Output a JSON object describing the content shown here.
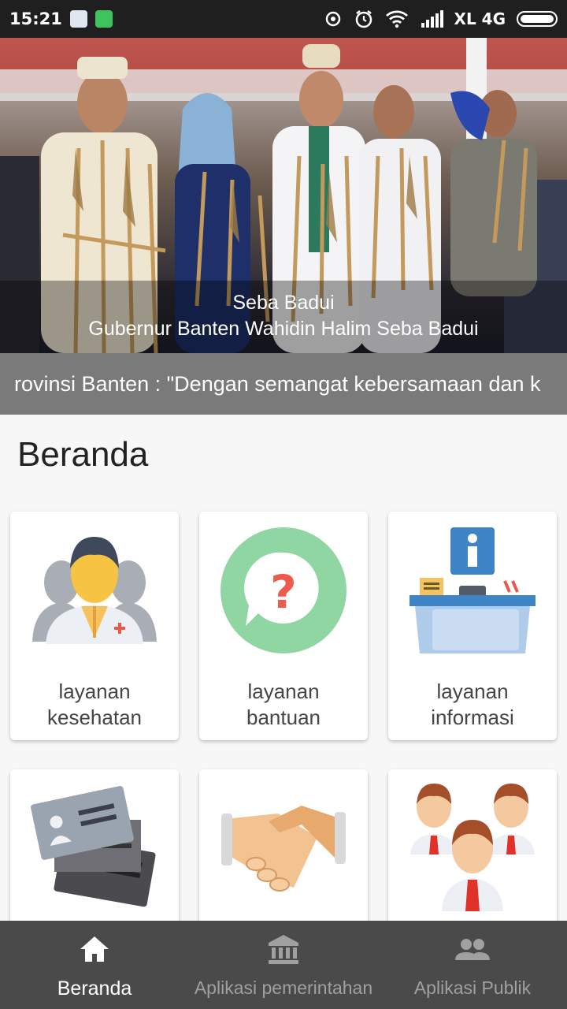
{
  "status_bar": {
    "time": "15:21",
    "carrier": "XL 4G",
    "icons": [
      "notification-app-icon",
      "whatsapp-icon",
      "sync-icon",
      "alarm-icon",
      "wifi-icon",
      "signal-icon",
      "battery-icon"
    ]
  },
  "hero": {
    "caption_title": "Seba Badui",
    "caption_subtitle": "Gubernur Banten Wahidin Halim Seba Badui"
  },
  "ticker": {
    "text": "rovinsi Banten : \"Dengan semangat kebersamaan dan k"
  },
  "page": {
    "title": "Beranda"
  },
  "cards": [
    {
      "line1": "layanan",
      "line2": "kesehatan",
      "icon": "doctor-icon"
    },
    {
      "line1": "layanan",
      "line2": "bantuan",
      "icon": "help-chat-icon"
    },
    {
      "line1": "layanan",
      "line2": "informasi",
      "icon": "info-desk-icon"
    },
    {
      "line1": "",
      "line2": "",
      "icon": "id-cards-icon"
    },
    {
      "line1": "",
      "line2": "",
      "icon": "handshake-icon"
    },
    {
      "line1": "",
      "line2": "",
      "icon": "people-group-icon"
    }
  ],
  "bottom_nav": {
    "items": [
      {
        "label": "Beranda",
        "icon": "home-icon",
        "active": true
      },
      {
        "label": "Aplikasi pemerintahan",
        "icon": "government-building-icon",
        "active": false
      },
      {
        "label": "Aplikasi Publik",
        "icon": "people-icon",
        "active": false
      }
    ]
  },
  "colors": {
    "status_bar": "#1f1f1f",
    "ticker": "#7a7a7a",
    "bottom_nav": "#4a4a4a",
    "help_green": "#8fd6a3",
    "info_blue": "#3d85c6"
  }
}
